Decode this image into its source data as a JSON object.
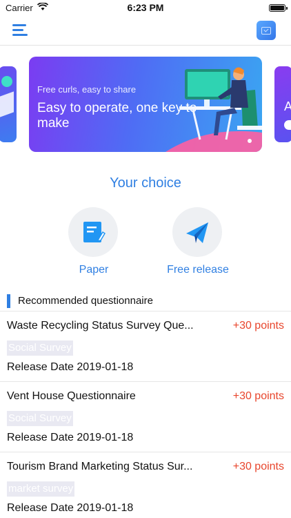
{
  "status_bar": {
    "carrier": "Carrier",
    "time": "6:23 PM",
    "battery_level": 1.0
  },
  "nav": {
    "menu_icon": "hamburger-menu-icon",
    "right_icon": "calendar-check-icon"
  },
  "banner": {
    "subtitle": "Free curls, easy to share",
    "title": "Easy to operate, one key to make",
    "side_right_text": "A"
  },
  "choice": {
    "title": "Your choice",
    "options": [
      {
        "label": "Paper",
        "icon": "edit-document-icon"
      },
      {
        "label": "Free release",
        "icon": "paper-plane-icon"
      }
    ]
  },
  "recommended": {
    "title": "Recommended questionnaire",
    "items": [
      {
        "title": "Waste Recycling Status Survey Que...",
        "points": "+30 points",
        "tag": "Social Survey",
        "date": "Release Date 2019-01-18"
      },
      {
        "title": "Vent House Questionnaire",
        "points": "+30 points",
        "tag": "Social Survey",
        "date": "Release Date 2019-01-18"
      },
      {
        "title": "Tourism Brand Marketing Status Sur...",
        "points": "+30 points",
        "tag": "market survey",
        "date": "Release Date 2019-01-18"
      }
    ]
  },
  "colors": {
    "accent": "#2f7fe2",
    "points": "#e8452c",
    "tag_bg": "#e9e9f2"
  }
}
